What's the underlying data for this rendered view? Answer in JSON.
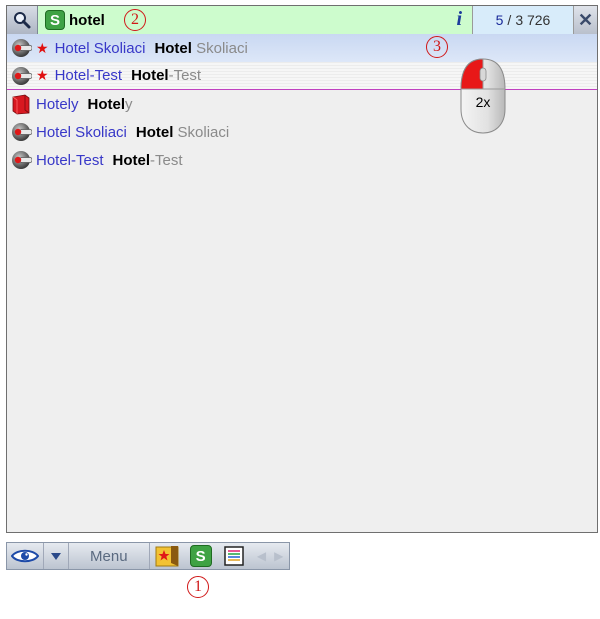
{
  "search": {
    "query": "hotel",
    "mode_badge": "S",
    "info_icon_glyph": "i",
    "counter_current": "5",
    "counter_separator": "/",
    "counter_total": "3 726"
  },
  "results": [
    {
      "title": "Hotel Skoliaci",
      "match": "Hotel",
      "rest": "Skoliaci",
      "star": "★",
      "icon": "location-pin-icon"
    },
    {
      "title": "Hotel-Test",
      "match": "Hotel",
      "rest": "-Test",
      "star": "★",
      "icon": "location-pin-icon"
    },
    {
      "title": "Hotely",
      "match": "Hotel",
      "rest": "y",
      "icon": "category-book-icon"
    },
    {
      "title": "Hotel Skoliaci",
      "match": "Hotel",
      "rest": " Skoliaci",
      "icon": "location-pin-icon"
    },
    {
      "title": "Hotel-Test",
      "match": "Hotel",
      "rest": "-Test",
      "icon": "location-pin-icon"
    }
  ],
  "annotations": {
    "one": "1",
    "two": "2",
    "three": "3",
    "mouse_label": "2x"
  },
  "toolbar": {
    "menu_label": "Menu",
    "s_label": "S"
  },
  "colors": {
    "search_field": "#cdfccd",
    "counter_bg": "#d8ecfa",
    "link": "#3838c8",
    "annotation": "#d01818",
    "selection": "#c9d8f2"
  }
}
